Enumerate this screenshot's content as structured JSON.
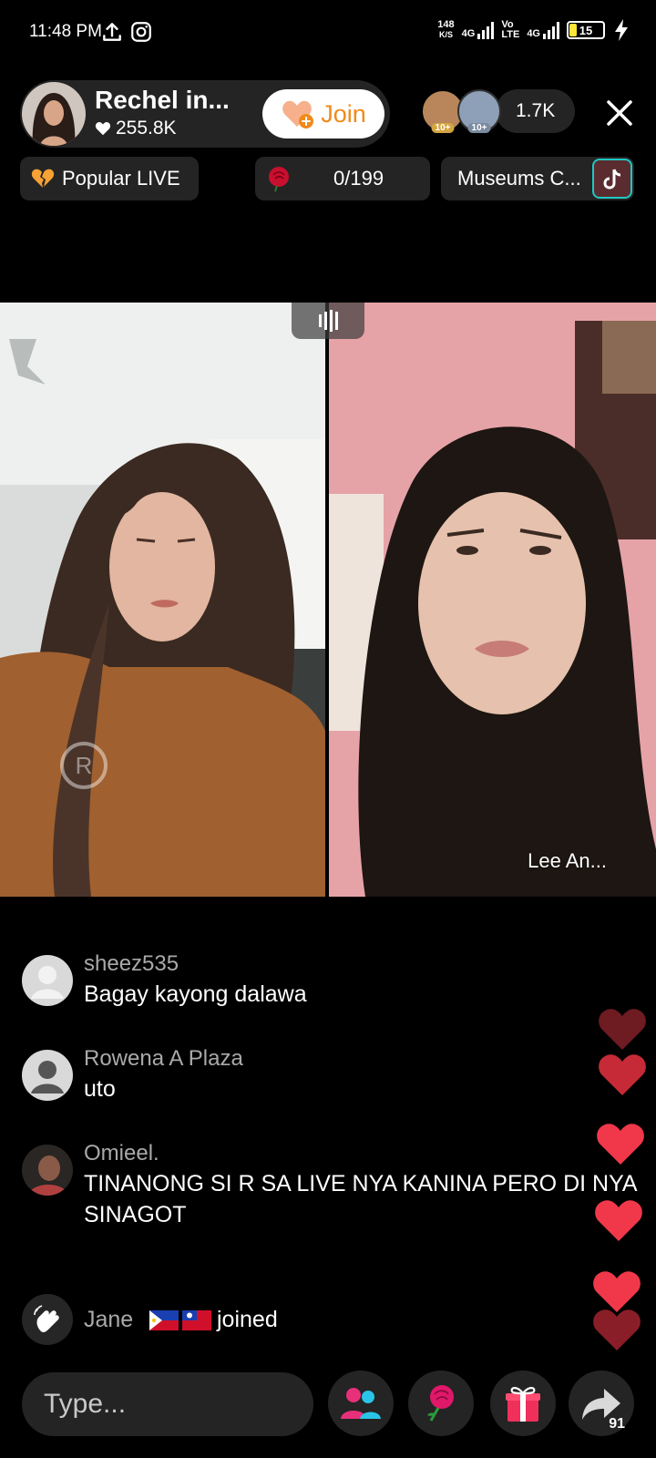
{
  "status_bar": {
    "time": "11:48 PM",
    "net_speed_value": "148",
    "net_speed_unit": "K/S",
    "network_1": "4G",
    "volte_top": "Vo",
    "volte_bottom": "LTE",
    "network_2": "4G",
    "battery": "15"
  },
  "host": {
    "name": "Rechel in...",
    "likes": "255.8K",
    "join_label": "Join"
  },
  "viewers": {
    "badge_1": "10+",
    "badge_2": "10+",
    "count": "1.7K"
  },
  "pills": {
    "popular_label": "Popular LIVE",
    "rose_count": "0/199",
    "museum_label": "Museums C..."
  },
  "video": {
    "partner_name": "Lee An..."
  },
  "comments": [
    {
      "user": "sheez535",
      "text": "Bagay kayong dalawa"
    },
    {
      "user": "Rowena A Plaza",
      "text": "uto"
    },
    {
      "user": "Omieel.",
      "text": "TINANONG SI R SA LIVE NYA KANINA PERO DI NYA SINAGOT"
    }
  ],
  "joined": {
    "name": "Jane",
    "text": "joined"
  },
  "bottom_bar": {
    "type_placeholder": "Type...",
    "share_count": "91"
  },
  "colors": {
    "join_text": "#f08a1a",
    "heart_red": "#f0384a",
    "battery_fill": "#ffe43a"
  }
}
